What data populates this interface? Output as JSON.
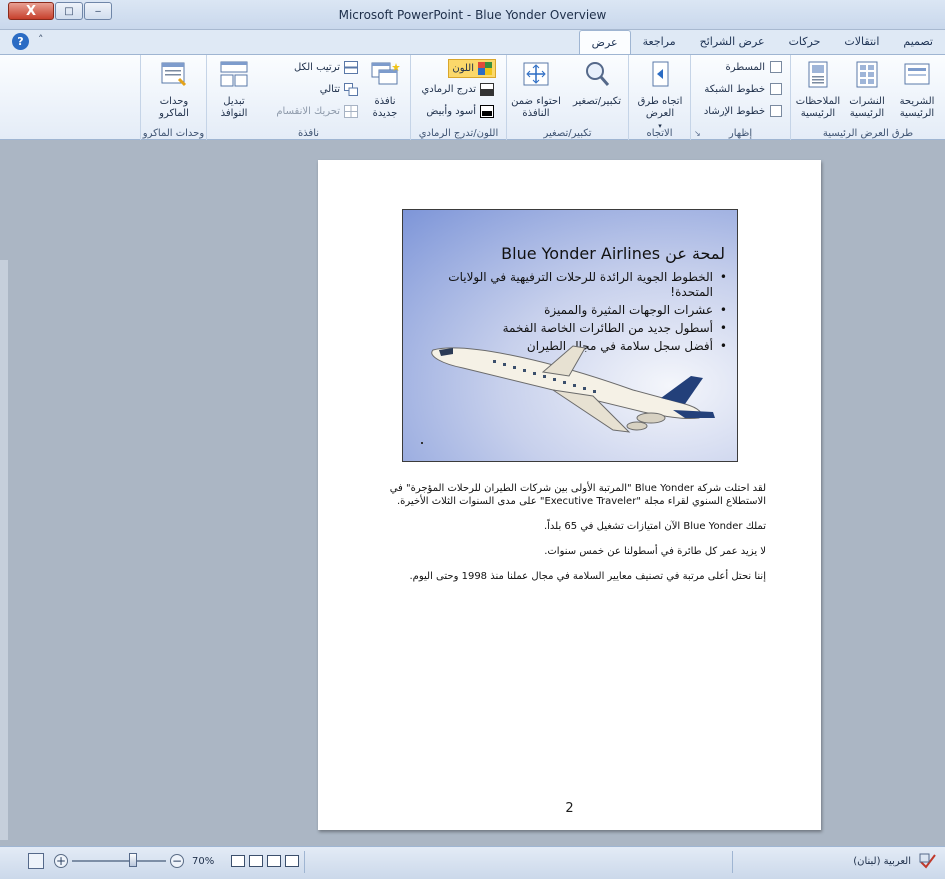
{
  "window": {
    "title": "Microsoft PowerPoint - Blue Yonder Overview",
    "close_label": "X",
    "maximize_label": "□",
    "minimize_label": "‒"
  },
  "tabs": [
    {
      "label": "تصميم"
    },
    {
      "label": "انتقالات"
    },
    {
      "label": "حركات"
    },
    {
      "label": "عرض الشرائح"
    },
    {
      "label": "مراجعة"
    },
    {
      "label": "عرض",
      "active": true
    }
  ],
  "help_label": "?",
  "ribbon": {
    "presentation_views": {
      "label": "طرق العرض الرئيسية",
      "slide_master": "الشريحة\nالرئيسية",
      "handout_master": "النشرات\nالرئيسية",
      "notes_master": "الملاحظات\nالرئيسية"
    },
    "show": {
      "label": "إظهار",
      "ruler": "المسطرة",
      "gridlines": "خطوط الشبكة",
      "guides": "خطوط الإرشاد"
    },
    "direction": {
      "label": "الاتجاه",
      "view_direction": "اتجاه طرق\nالعرض"
    },
    "zoom": {
      "label": "تكبير/تصغير",
      "zoom": "تكبير/تصغير",
      "fit": "احتواء ضمن\nالنافذة"
    },
    "color": {
      "label": "اللون/تدرج الرمادي",
      "color": "اللون",
      "grayscale": "تدرج الرمادي",
      "bw": "أسود وأبيض"
    },
    "window": {
      "label": "نافذة",
      "new_window": "نافذة\nجديدة",
      "arrange_all": "ترتيب الكل",
      "cascade": "تتالي",
      "move_split": "تحريك الانقسام",
      "switch_windows": "تبديل\nالنوافذ"
    },
    "macros": {
      "label": "وحدات الماكرو",
      "macros": "وحدات\nالماكرو"
    }
  },
  "slide": {
    "title": "لمحة عن Blue Yonder Airlines",
    "bullets": [
      "الخطوط الجوية الرائدة للرحلات الترفيهية في الولايات المتحدة!",
      "عشرات الوجهات المثيرة والمميزة",
      "أسطول جديد من الطائرات الخاصة الفخمة",
      "أفضل سجل سلامة في مجال الطيران"
    ]
  },
  "notes": [
    "لقد احتلت شركة Blue Yonder \"المرتبة الأولى بين شركات الطيران للرحلات المؤجرة\" في الاستطلاع السنوي لقراء مجلة \"Executive Traveler\" على مدى السنوات الثلاث الأخيرة.",
    "تملك Blue Yonder الآن امتيازات تشغيل في 65 بلداً.",
    "لا يزيد عمر كل طائرة في أسطولنا عن خمس سنوات.",
    "إننا نحتل أعلى مرتبة في تصنيف معايير السلامة في مجال عملنا منذ 1998 وحتى اليوم."
  ],
  "page_number": "2",
  "status": {
    "language": "العربية (لبنان)",
    "zoom_percent": "70%",
    "zoom_level": 0.7
  }
}
